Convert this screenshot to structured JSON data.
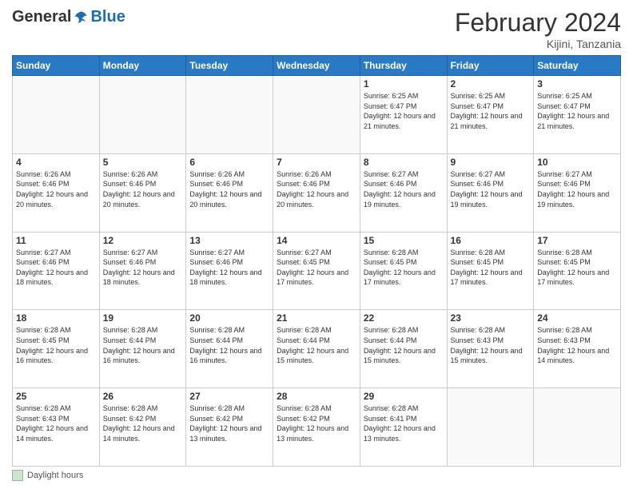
{
  "header": {
    "logo_general": "General",
    "logo_blue": "Blue",
    "main_title": "February 2024",
    "subtitle": "Kijini, Tanzania"
  },
  "footer": {
    "label": "Daylight hours"
  },
  "calendar": {
    "headers": [
      "Sunday",
      "Monday",
      "Tuesday",
      "Wednesday",
      "Thursday",
      "Friday",
      "Saturday"
    ],
    "weeks": [
      [
        {
          "day": "",
          "info": ""
        },
        {
          "day": "",
          "info": ""
        },
        {
          "day": "",
          "info": ""
        },
        {
          "day": "",
          "info": ""
        },
        {
          "day": "1",
          "info": "Sunrise: 6:25 AM\nSunset: 6:47 PM\nDaylight: 12 hours and 21 minutes."
        },
        {
          "day": "2",
          "info": "Sunrise: 6:25 AM\nSunset: 6:47 PM\nDaylight: 12 hours and 21 minutes."
        },
        {
          "day": "3",
          "info": "Sunrise: 6:25 AM\nSunset: 6:47 PM\nDaylight: 12 hours and 21 minutes."
        }
      ],
      [
        {
          "day": "4",
          "info": "Sunrise: 6:26 AM\nSunset: 6:46 PM\nDaylight: 12 hours and 20 minutes."
        },
        {
          "day": "5",
          "info": "Sunrise: 6:26 AM\nSunset: 6:46 PM\nDaylight: 12 hours and 20 minutes."
        },
        {
          "day": "6",
          "info": "Sunrise: 6:26 AM\nSunset: 6:46 PM\nDaylight: 12 hours and 20 minutes."
        },
        {
          "day": "7",
          "info": "Sunrise: 6:26 AM\nSunset: 6:46 PM\nDaylight: 12 hours and 20 minutes."
        },
        {
          "day": "8",
          "info": "Sunrise: 6:27 AM\nSunset: 6:46 PM\nDaylight: 12 hours and 19 minutes."
        },
        {
          "day": "9",
          "info": "Sunrise: 6:27 AM\nSunset: 6:46 PM\nDaylight: 12 hours and 19 minutes."
        },
        {
          "day": "10",
          "info": "Sunrise: 6:27 AM\nSunset: 6:46 PM\nDaylight: 12 hours and 19 minutes."
        }
      ],
      [
        {
          "day": "11",
          "info": "Sunrise: 6:27 AM\nSunset: 6:46 PM\nDaylight: 12 hours and 18 minutes."
        },
        {
          "day": "12",
          "info": "Sunrise: 6:27 AM\nSunset: 6:46 PM\nDaylight: 12 hours and 18 minutes."
        },
        {
          "day": "13",
          "info": "Sunrise: 6:27 AM\nSunset: 6:46 PM\nDaylight: 12 hours and 18 minutes."
        },
        {
          "day": "14",
          "info": "Sunrise: 6:27 AM\nSunset: 6:45 PM\nDaylight: 12 hours and 17 minutes."
        },
        {
          "day": "15",
          "info": "Sunrise: 6:28 AM\nSunset: 6:45 PM\nDaylight: 12 hours and 17 minutes."
        },
        {
          "day": "16",
          "info": "Sunrise: 6:28 AM\nSunset: 6:45 PM\nDaylight: 12 hours and 17 minutes."
        },
        {
          "day": "17",
          "info": "Sunrise: 6:28 AM\nSunset: 6:45 PM\nDaylight: 12 hours and 17 minutes."
        }
      ],
      [
        {
          "day": "18",
          "info": "Sunrise: 6:28 AM\nSunset: 6:45 PM\nDaylight: 12 hours and 16 minutes."
        },
        {
          "day": "19",
          "info": "Sunrise: 6:28 AM\nSunset: 6:44 PM\nDaylight: 12 hours and 16 minutes."
        },
        {
          "day": "20",
          "info": "Sunrise: 6:28 AM\nSunset: 6:44 PM\nDaylight: 12 hours and 16 minutes."
        },
        {
          "day": "21",
          "info": "Sunrise: 6:28 AM\nSunset: 6:44 PM\nDaylight: 12 hours and 15 minutes."
        },
        {
          "day": "22",
          "info": "Sunrise: 6:28 AM\nSunset: 6:44 PM\nDaylight: 12 hours and 15 minutes."
        },
        {
          "day": "23",
          "info": "Sunrise: 6:28 AM\nSunset: 6:43 PM\nDaylight: 12 hours and 15 minutes."
        },
        {
          "day": "24",
          "info": "Sunrise: 6:28 AM\nSunset: 6:43 PM\nDaylight: 12 hours and 14 minutes."
        }
      ],
      [
        {
          "day": "25",
          "info": "Sunrise: 6:28 AM\nSunset: 6:43 PM\nDaylight: 12 hours and 14 minutes."
        },
        {
          "day": "26",
          "info": "Sunrise: 6:28 AM\nSunset: 6:42 PM\nDaylight: 12 hours and 14 minutes."
        },
        {
          "day": "27",
          "info": "Sunrise: 6:28 AM\nSunset: 6:42 PM\nDaylight: 12 hours and 13 minutes."
        },
        {
          "day": "28",
          "info": "Sunrise: 6:28 AM\nSunset: 6:42 PM\nDaylight: 12 hours and 13 minutes."
        },
        {
          "day": "29",
          "info": "Sunrise: 6:28 AM\nSunset: 6:41 PM\nDaylight: 12 hours and 13 minutes."
        },
        {
          "day": "",
          "info": ""
        },
        {
          "day": "",
          "info": ""
        }
      ]
    ]
  }
}
